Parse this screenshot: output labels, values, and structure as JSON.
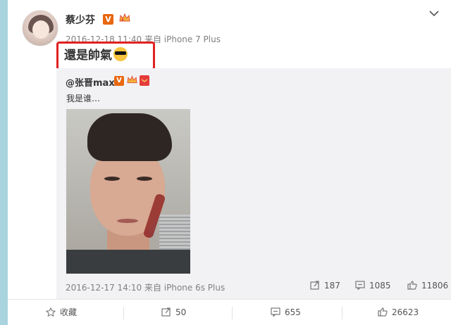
{
  "post": {
    "author": "蔡少芬",
    "verified_badge": "V",
    "meta": "2016-12-18 11:40 来自 iPhone 7 Plus",
    "text": "還是帥氣"
  },
  "repost": {
    "author": "@张晋max",
    "verified_badge": "V",
    "text": "我是谁…",
    "meta": "2016-12-17 14:10 来自 iPhone 6s Plus",
    "stats": {
      "reposts": "187",
      "comments": "1085",
      "likes": "11806"
    }
  },
  "footer": {
    "favorite_label": "收藏",
    "reposts": "50",
    "comments": "655",
    "likes": "26623"
  },
  "colors": {
    "highlight_border": "#e02121",
    "verified_orange": "#e8670f",
    "repost_bg": "#f2f2f5"
  }
}
